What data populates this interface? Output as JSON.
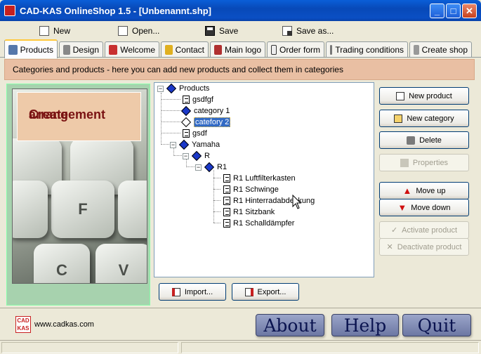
{
  "window": {
    "title": "CAD-KAS OnlineShop 1.5 - [Unbenannt.shp]"
  },
  "menu": {
    "new": "New",
    "open": "Open...",
    "save": "Save",
    "save_as": "Save as..."
  },
  "tabs": [
    "Products",
    "Design",
    "Welcome",
    "Contact",
    "Main logo",
    "Order form",
    "Trading conditions",
    "Create shop"
  ],
  "banner": "Categories and products - here you can add new products and collect them in categories",
  "arrangement": {
    "line1": "Create",
    "line2": "arrangement"
  },
  "keys": [
    "F",
    "C",
    "V"
  ],
  "tree": {
    "root": "Products",
    "items": [
      "gsdfgf",
      "category 1",
      "catefory 2",
      "gsdf",
      "Yamaha",
      "R",
      "R1",
      "R1 Luftfilterkasten",
      "R1 Schwinge",
      "R1 Hinterradabdeckung",
      "R1 Sitzbank",
      "R1 Schalldämpfer"
    ]
  },
  "buttons": {
    "new_product": "New product",
    "new_category": "New category",
    "delete": "Delete",
    "properties": "Properties",
    "move_up": "Move up",
    "move_down": "Move down",
    "activate": "Activate product",
    "deactivate": "Deactivate product",
    "import": "Import...",
    "export": "Export..."
  },
  "footer": {
    "url": "www.cadkas.com",
    "about": "About",
    "help": "Help",
    "quit": "Quit"
  }
}
